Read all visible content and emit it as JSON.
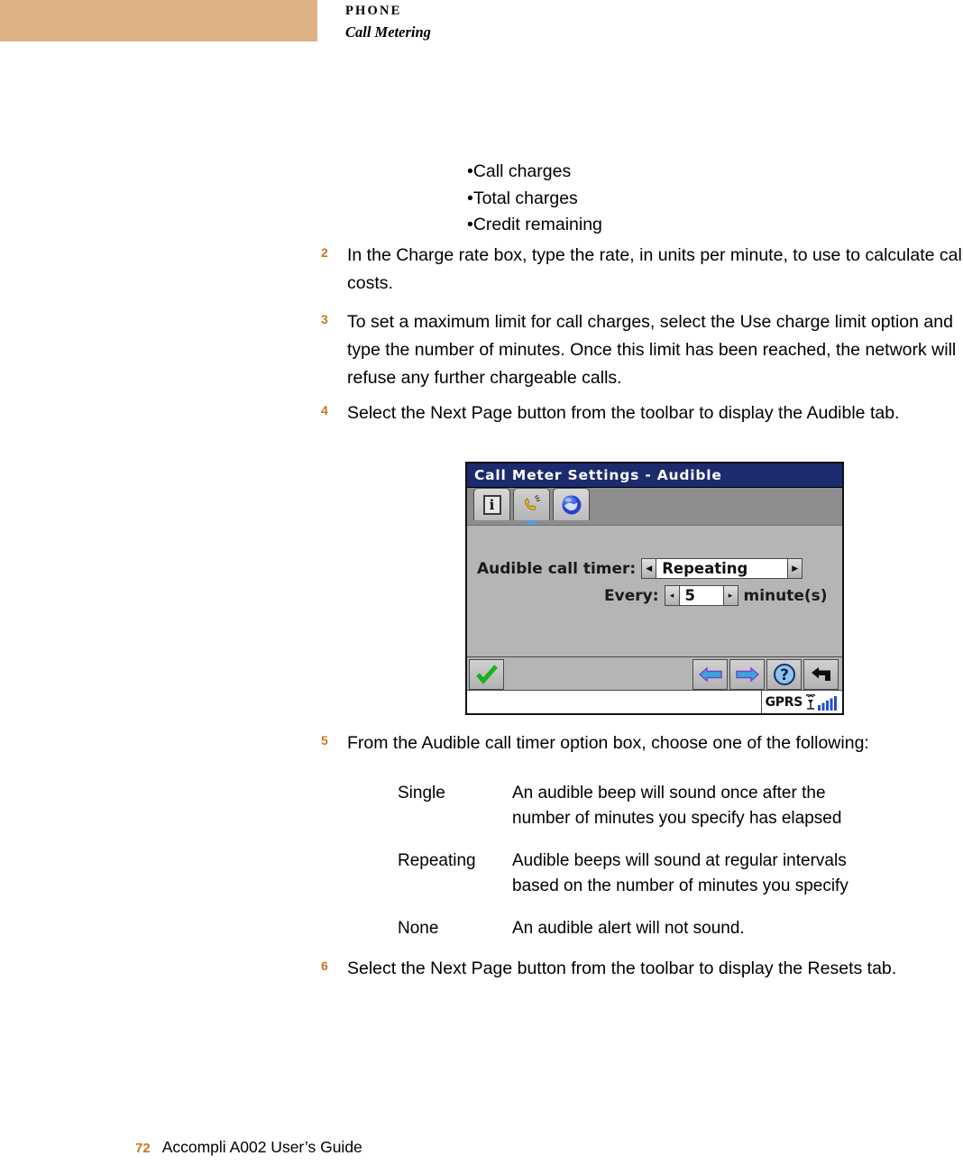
{
  "header": {
    "kicker": "PHONE",
    "section": "Call Metering",
    "band_color": "#dcb184"
  },
  "bullets": [
    "Call charges",
    "Total charges",
    "Credit remaining"
  ],
  "steps": [
    {
      "number": "2",
      "text": "In the Charge rate box, type the rate, in units per minute, to use to calculate call costs."
    },
    {
      "number": "3",
      "text": "To set a maximum limit for call charges, select the Use charge limit option and type the number of minutes. Once this limit has been reached, the network will refuse any further chargeable calls."
    },
    {
      "number": "4",
      "text": "Select the Next Page button from the toolbar to display the Audible tab."
    },
    {
      "number": "5",
      "text": "From the Audible call timer option box, choose one of the following:"
    },
    {
      "number": "6",
      "text": "Select the Next Page button from the toolbar to display the Resets tab."
    }
  ],
  "device_screenshot": {
    "title": "Call Meter Settings - Audible",
    "title_bar_color": "#1c2a6e",
    "tabs": [
      {
        "icon": "info-icon",
        "label": "i",
        "active": false
      },
      {
        "icon": "phone-handset-icon",
        "label": "",
        "active": true
      },
      {
        "icon": "globe-icon",
        "label": "",
        "active": false
      }
    ],
    "fields": [
      {
        "label": "Audible call timer:",
        "value": "Repeating",
        "control": "option-box"
      },
      {
        "label": "Every:",
        "value": "5",
        "suffix": "minute(s)",
        "control": "spinner"
      }
    ],
    "toolbar": [
      {
        "icon": "green-checkmark-icon",
        "name": "confirm-button"
      },
      {
        "icon": "previous-page-arrow-icon",
        "name": "previous-page-button"
      },
      {
        "icon": "next-page-arrow-icon",
        "name": "next-page-button"
      },
      {
        "icon": "help-question-icon",
        "name": "help-button"
      },
      {
        "icon": "back-arrow-icon",
        "name": "back-button"
      }
    ],
    "status_bar": {
      "network": "GPRS",
      "signal_icon": "signal-bars-icon",
      "signal_bars": 5
    }
  },
  "definitions": [
    {
      "term": "Single",
      "description_lines": [
        "An audible beep will sound once after the",
        "number of minutes you specify has elapsed"
      ]
    },
    {
      "term": "Repeating",
      "description_lines": [
        "Audible beeps will sound at regular intervals",
        "based on the number of minutes you specify"
      ]
    },
    {
      "term": "None",
      "description_lines": [
        "An audible alert will not sound."
      ]
    }
  ],
  "footer": {
    "page_number": "72",
    "document_title": "Accompli A002 User’s Guide",
    "page_number_color": "#C8761E"
  }
}
